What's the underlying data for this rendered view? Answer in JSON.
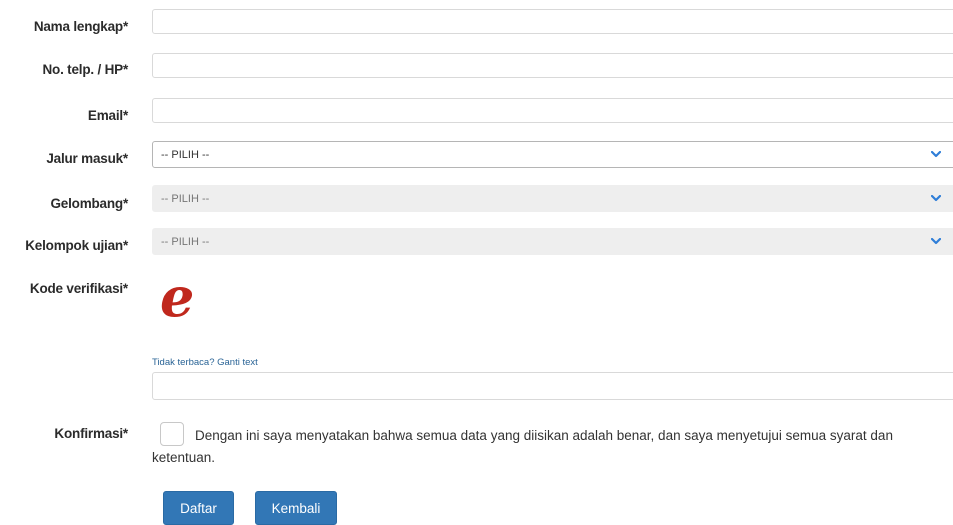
{
  "form": {
    "fields": [
      {
        "label": "Nama lengkap*",
        "value": ""
      },
      {
        "label": "No. telp. / HP*",
        "value": ""
      },
      {
        "label": "Email*",
        "value": ""
      },
      {
        "label": "Jalur masuk*",
        "selected": "-- PILIH --",
        "enabled": true
      },
      {
        "label": "Gelombang*",
        "selected": "-- PILIH --",
        "enabled": false
      },
      {
        "label": "Kelompok ujian*",
        "selected": "-- PILIH --",
        "enabled": false
      }
    ],
    "captcha": {
      "label": "Kode verifikasi*",
      "image_text": "e",
      "refresh_link": "Tidak terbaca? Ganti text",
      "input_value": ""
    },
    "confirmation": {
      "label": "Konfirmasi*",
      "checked": false,
      "text": "Dengan ini saya menyatakan bahwa semua data yang diisikan adalah benar, dan saya menyetujui semua syarat dan ketentuan."
    },
    "buttons": {
      "submit_label": "Daftar",
      "back_label": "Kembali"
    }
  },
  "colors": {
    "primary_button": "#3277b6",
    "chevron": "#2f7ed8",
    "captcha": "#c0281d",
    "link": "#2a6496"
  },
  "icons": {
    "select_arrow": "chevron-down-icon"
  }
}
